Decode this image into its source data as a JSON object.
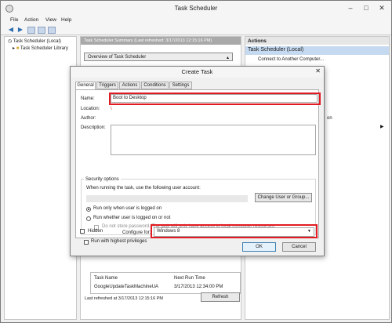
{
  "window": {
    "title": "Task Scheduler"
  },
  "menu": [
    "File",
    "Action",
    "View",
    "Help"
  ],
  "tree": {
    "items": [
      "Task Scheduler (Local)",
      "Task Scheduler Library"
    ]
  },
  "center": {
    "header": "Task Scheduler Summary (Last refreshed: 3/17/2013 12:15:16 PM)",
    "overview_label": "Overview of Task Scheduler",
    "task_columns": [
      "Task Name",
      "Next Run Time"
    ],
    "task_rows": [
      [
        "GoogleUpdateTaskMachineUA",
        "3/17/2013 12:34:00 PM"
      ]
    ],
    "status": "Last refreshed at 3/17/2013 12:15:16 PM",
    "refresh_label": "Refresh"
  },
  "actions": {
    "header": "Actions",
    "selected": "Task Scheduler (Local)",
    "items": [
      "Connect to Another Computer..."
    ],
    "partial_item": "on"
  },
  "dialog": {
    "title": "Create Task",
    "tabs": [
      "General",
      "Triggers",
      "Actions",
      "Conditions",
      "Settings"
    ],
    "name_label": "Name:",
    "name_value": "Boot to Desktop",
    "location_label": "Location:",
    "location_value": "\\",
    "author_label": "Author:",
    "description_label": "Description:",
    "security_title": "Security options",
    "account_prompt": "When running the task, use the following user account:",
    "change_user_label": "Change User or Group...",
    "radio_logged_on": "Run only when user is logged on",
    "radio_whether": "Run whether user is logged on or not",
    "no_store_password": "Do not store password.  The task will only have access to local computer resources.",
    "highest_privileges": "Run with highest privileges",
    "hidden_label": "Hidden",
    "configure_label": "Configure for:",
    "configure_value": "Windows 8",
    "ok_label": "OK",
    "cancel_label": "Cancel"
  },
  "colors": {
    "highlight_border": "#e21b23",
    "accent": "#c5daf0"
  }
}
